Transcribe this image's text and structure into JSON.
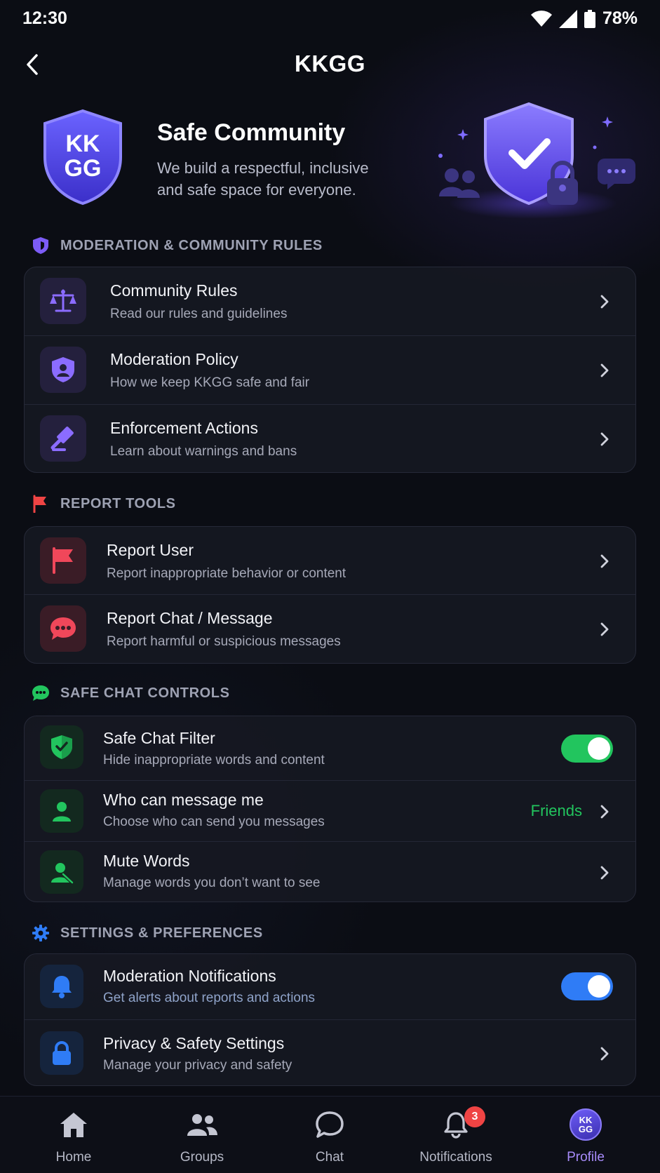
{
  "status_bar": {
    "time": "12:30",
    "battery": "78%"
  },
  "header": {
    "title": "KKGG"
  },
  "hero": {
    "logo_text_top": "KK",
    "logo_text_bottom": "GG",
    "title": "Safe Community",
    "description": "We build a respectful, inclusive and safe space for everyone."
  },
  "sections": {
    "moderation": {
      "title": "MODERATION & COMMUNITY RULES",
      "items": [
        {
          "title": "Community Rules",
          "subtitle": "Read our rules and guidelines",
          "icon": "scale-icon"
        },
        {
          "title": "Moderation Policy",
          "subtitle": "How we keep KKGG safe and fair",
          "icon": "shield-user-icon"
        },
        {
          "title": "Enforcement Actions",
          "subtitle": "Learn about warnings and bans",
          "icon": "gavel-icon"
        }
      ]
    },
    "report": {
      "title": "REPORT TOOLS",
      "items": [
        {
          "title": "Report User",
          "subtitle": "Report inappropriate behavior or content",
          "icon": "flag-icon"
        },
        {
          "title": "Report Chat / Message",
          "subtitle": "Report harmful or suspicious messages",
          "icon": "chat-bubble-icon"
        }
      ]
    },
    "safe_chat": {
      "title": "SAFE CHAT CONTROLS",
      "items": [
        {
          "title": "Safe Chat Filter",
          "subtitle": "Hide inappropriate words and content",
          "icon": "shield-check-icon",
          "toggle_on": true
        },
        {
          "title": "Who can message me",
          "subtitle": "Choose who can send you messages",
          "icon": "user-icon",
          "value": "Friends"
        },
        {
          "title": "Mute Words",
          "subtitle": "Manage words you don’t want to see",
          "icon": "user-mute-icon"
        }
      ]
    },
    "settings": {
      "title": "SETTINGS & PREFERENCES",
      "items": [
        {
          "title": "Moderation Notifications",
          "subtitle": "Get alerts about reports and actions",
          "icon": "bell-icon",
          "toggle_on": true
        },
        {
          "title": "Privacy & Safety Settings",
          "subtitle": "Manage your privacy and safety",
          "icon": "lock-icon"
        }
      ]
    }
  },
  "bottom_nav": {
    "items": [
      {
        "label": "Home",
        "icon": "home-icon"
      },
      {
        "label": "Groups",
        "icon": "groups-icon"
      },
      {
        "label": "Chat",
        "icon": "chat-icon"
      },
      {
        "label": "Notifications",
        "icon": "bell-icon",
        "badge": "3"
      },
      {
        "label": "Profile",
        "icon": "profile-avatar",
        "active": true
      }
    ],
    "avatar_top": "KK",
    "avatar_bottom": "GG"
  },
  "colors": {
    "accent_purple": "#7c5cf6",
    "report_red": "#ef4444",
    "safe_green": "#22c55e",
    "settings_blue": "#2f7cf6"
  }
}
